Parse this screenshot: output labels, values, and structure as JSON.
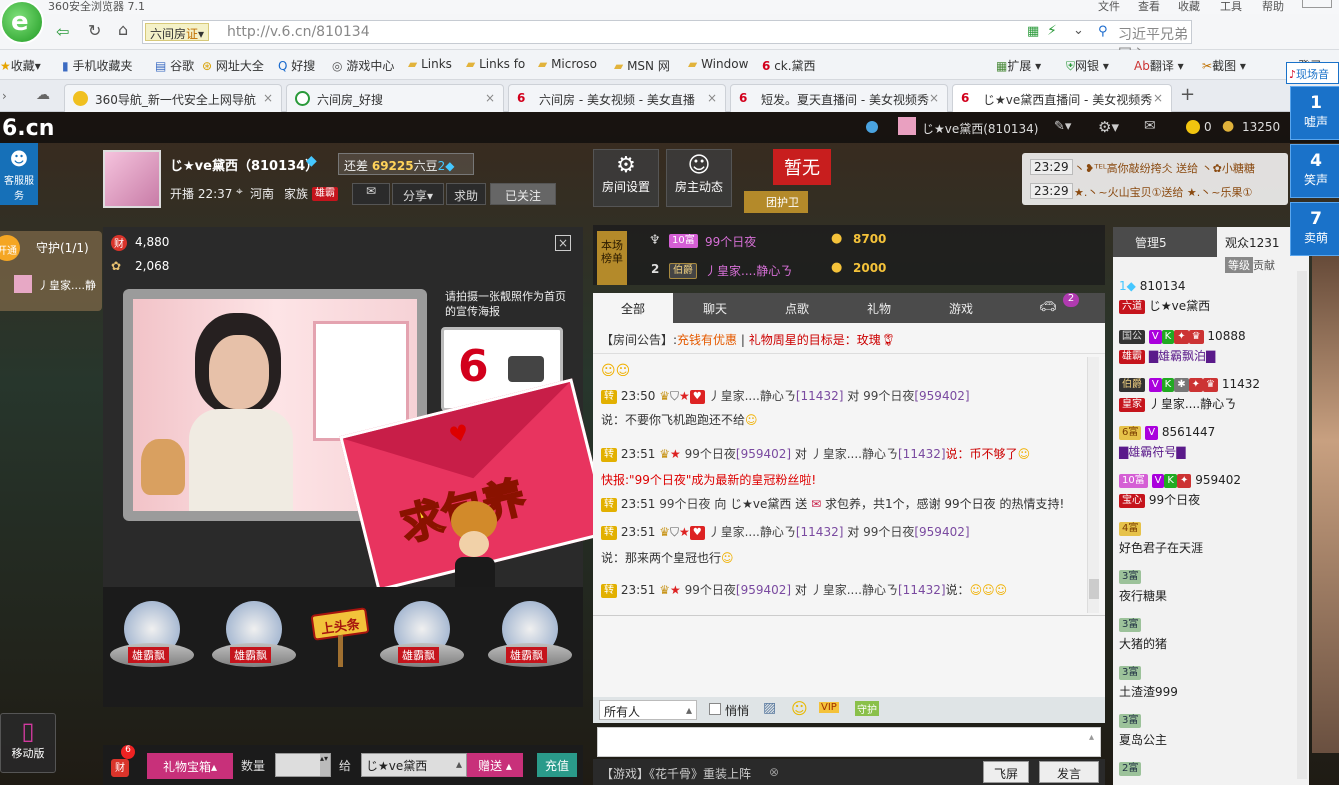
{
  "browser": {
    "title": "360安全浏览器 7.1",
    "menu": [
      "文件",
      "查看",
      "收藏",
      "工具",
      "帮助"
    ],
    "site_name": "六间房",
    "cert_label": "证",
    "url": "http://v.6.cn/810134",
    "search_text": "习近平兄弟同心",
    "favorites": [
      "收藏",
      "手机收藏夹",
      "谷歌",
      "网址大全",
      "好搜",
      "游戏中心",
      "Links",
      "Links fo",
      "Microso",
      "MSN 网",
      "Window",
      "ck.黛西"
    ],
    "fav_right": [
      "扩展",
      "网银",
      "翻译",
      "截图",
      "登录"
    ],
    "tabs": [
      {
        "label": "360导航_新一代安全上网导航",
        "active": false
      },
      {
        "label": "六间房_好搜",
        "active": false
      },
      {
        "label": "六间房 - 美女视频 - 美女直播",
        "active": false
      },
      {
        "label": "短发。夏天直播间 - 美女视频秀",
        "active": false
      },
      {
        "label": "じ★ve黛西直播间 - 美女视频秀",
        "active": true
      }
    ],
    "new_tab": "+"
  },
  "site": {
    "logo": "6.cn",
    "top_user": "じ★ve黛西(810134)",
    "coins": "0",
    "beans": "13250",
    "side_service": "客服服务"
  },
  "host": {
    "name": "じ★ve黛西（810134）",
    "rank_prefix": "还差",
    "rank_value": "69225",
    "rank_suffix": "六豆",
    "live_time": "开播 22:37",
    "location": "河南",
    "family_label": "家族",
    "family_tag": "雄霸",
    "share": "分享",
    "help": "求助",
    "followed": "已关注"
  },
  "room_buttons": {
    "settings": "房间设置",
    "dynamics": "房主动态",
    "seat": "暂无",
    "guard_badge": "团护卫"
  },
  "gift_ticker": [
    {
      "time": "23:29",
      "text": "丶❥ᵀᴱᴸ高你敲纷挎仌 送给 丶✿小糖糖"
    },
    {
      "time": "23:29",
      "text": "★.丶~火山宝贝①送给 ★.丶~乐果①"
    }
  ],
  "guard": {
    "vip": "开通",
    "label": "守护(1/1)",
    "member": "丿皇家....静"
  },
  "video": {
    "wealth": "4,880",
    "popularity": "2,068",
    "poster_hint": "请拍摄一张靓照作为首页的宣传海报",
    "envelope_text": "求包养",
    "headline": "上头条",
    "mic_names": [
      "雄霸飘",
      "雄霸飘",
      "雄霸飘",
      "雄霸飘"
    ]
  },
  "rankboard": {
    "label": "本场榜单",
    "rows": [
      {
        "rank": "1",
        "badge": "10富",
        "name": "99个日夜",
        "score": "8700"
      },
      {
        "rank": "2",
        "badge": "伯爵",
        "name": "丿皇家....静心ㄋ",
        "score": "2000"
      }
    ]
  },
  "chat": {
    "tabs": [
      "全部",
      "聊天",
      "点歌",
      "礼物",
      "游戏"
    ],
    "car_count": "2",
    "notice_label": "【房间公告】:",
    "notice_a": "充钱有优惠",
    "notice_b": "礼物周星的目标是：玫瑰",
    "lines": [
      {
        "tag": "转",
        "time": "23:50",
        "from": "丿皇家....静心ㄋ",
        "from_id": "[11432]",
        "mid": "对",
        "to": "99个日夜",
        "to_id": "[959402]",
        "say": "说：不要你飞机跑跑还不给"
      },
      {
        "tag": "转",
        "time": "23:51",
        "from": "99个日夜",
        "from_id": "[959402]",
        "mid": "对",
        "to": "丿皇家....静心ㄋ",
        "to_id": "[11432]",
        "say": "说：币不够了"
      },
      {
        "tag": "",
        "time": "",
        "from": "快报:",
        "from_id": "",
        "mid": "",
        "to": "",
        "to_id": "",
        "say": "\"99个日夜\"成为最新的皇冠粉丝啦!"
      },
      {
        "tag": "转",
        "time": "23:51",
        "from": "99个日夜",
        "from_id": "",
        "mid": "向 じ★ve黛西 送",
        "to": "",
        "to_id": "",
        "say": "求包养，共1个，感谢 99个日夜 的热情支持!"
      },
      {
        "tag": "转",
        "time": "23:51",
        "from": "丿皇家....静心ㄋ",
        "from_id": "[11432]",
        "mid": "对",
        "to": "99个日夜",
        "to_id": "[959402]",
        "say": "说：那来两个皇冠也行"
      },
      {
        "tag": "转",
        "time": "23:51",
        "from": "99个日夜",
        "from_id": "[959402]",
        "mid": "对",
        "to": "丿皇家....静心ㄋ",
        "to_id": "[11432]",
        "say": "说："
      }
    ],
    "recipient": "所有人",
    "whisper": "悄悄",
    "vip_btn": "VIP",
    "guard_btn": "守护",
    "input_placeholder": "",
    "ad": "【游戏】《花千骨》重装上阵",
    "fly_btn": "飞屏",
    "send_btn": "发言"
  },
  "giftbar": {
    "wealth_count": "6",
    "box": "礼物宝箱",
    "qty_label": "数量",
    "to_label": "给",
    "to_value": "じ★ve黛西",
    "send": "赠送",
    "recharge": "充值",
    "mobile": "移动版"
  },
  "userlist": {
    "tab_admin": "管理5",
    "tab_audience": "观众1231",
    "sort_level": "等级",
    "sort_contrib": "贡献",
    "users": [
      {
        "badge": "",
        "id": "810134",
        "tag": "六道",
        "name": "じ★ve黛西"
      },
      {
        "badge": "国公",
        "id": "10888",
        "tag": "雄霸",
        "name": "▇雄霸飘泊▇"
      },
      {
        "badge": "伯爵",
        "id": "11432",
        "tag": "皇家",
        "name": "丿皇家....静心ㄋ"
      },
      {
        "badge": "6富",
        "id": "8561447",
        "tag": "",
        "name": "▇雄霸符号▇"
      },
      {
        "badge": "10富",
        "id": "959402",
        "tag": "宝心",
        "name": "99个日夜"
      },
      {
        "badge": "4富",
        "id": "",
        "tag": "",
        "name": "好色君子在天涯"
      },
      {
        "badge": "3富",
        "id": "",
        "tag": "",
        "name": "夜行糖果"
      },
      {
        "badge": "3富",
        "id": "",
        "tag": "",
        "name": "大猪的猪"
      },
      {
        "badge": "3富",
        "id": "",
        "tag": "",
        "name": "土渣渣999"
      },
      {
        "badge": "3富",
        "id": "",
        "tag": "",
        "name": "夏岛公主"
      },
      {
        "badge": "2富",
        "id": "",
        "tag": "",
        "name": ""
      }
    ]
  },
  "live_panel": {
    "title": "现场音",
    "buttons": [
      {
        "num": "1",
        "label": "嘘声"
      },
      {
        "num": "4",
        "label": "笑声"
      },
      {
        "num": "7",
        "label": "卖萌"
      }
    ]
  }
}
